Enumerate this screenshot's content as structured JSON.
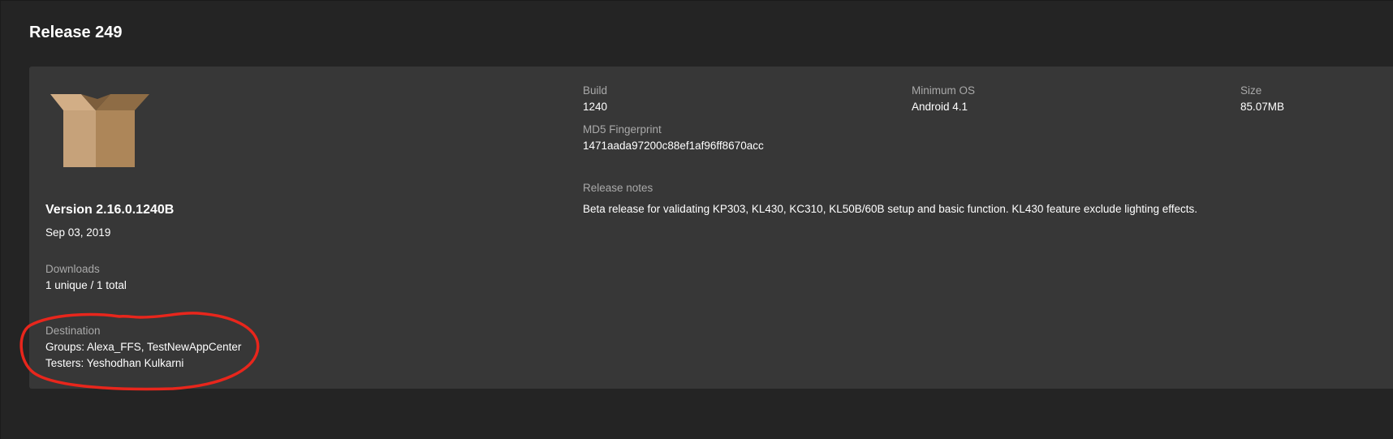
{
  "page": {
    "title": "Release 249"
  },
  "release": {
    "version": "Version 2.16.0.1240B",
    "date": "Sep 03, 2019",
    "downloads": {
      "label": "Downloads",
      "value": "1 unique / 1 total"
    },
    "destination": {
      "label": "Destination",
      "groups": "Groups: Alexa_FFS, TestNewAppCenter",
      "testers": "Testers: Yeshodhan Kulkarni"
    },
    "build": {
      "label": "Build",
      "value": "1240"
    },
    "min_os": {
      "label": "Minimum OS",
      "value": "Android 4.1"
    },
    "size": {
      "label": "Size",
      "value": "85.07MB"
    },
    "md5": {
      "label": "MD5 Fingerprint",
      "value": "1471aada97200c88ef1af96ff8670acc"
    },
    "notes": {
      "label": "Release notes",
      "value": "Beta release for validating KP303, KL430, KC310, KL50B/60B setup and basic function. KL430 feature exclude lighting effects."
    }
  },
  "icons": {
    "app": "package-box-icon"
  },
  "colors": {
    "background": "#242424",
    "card": "#373737",
    "annotation": "#e8261c",
    "label": "#a9a9a9"
  }
}
